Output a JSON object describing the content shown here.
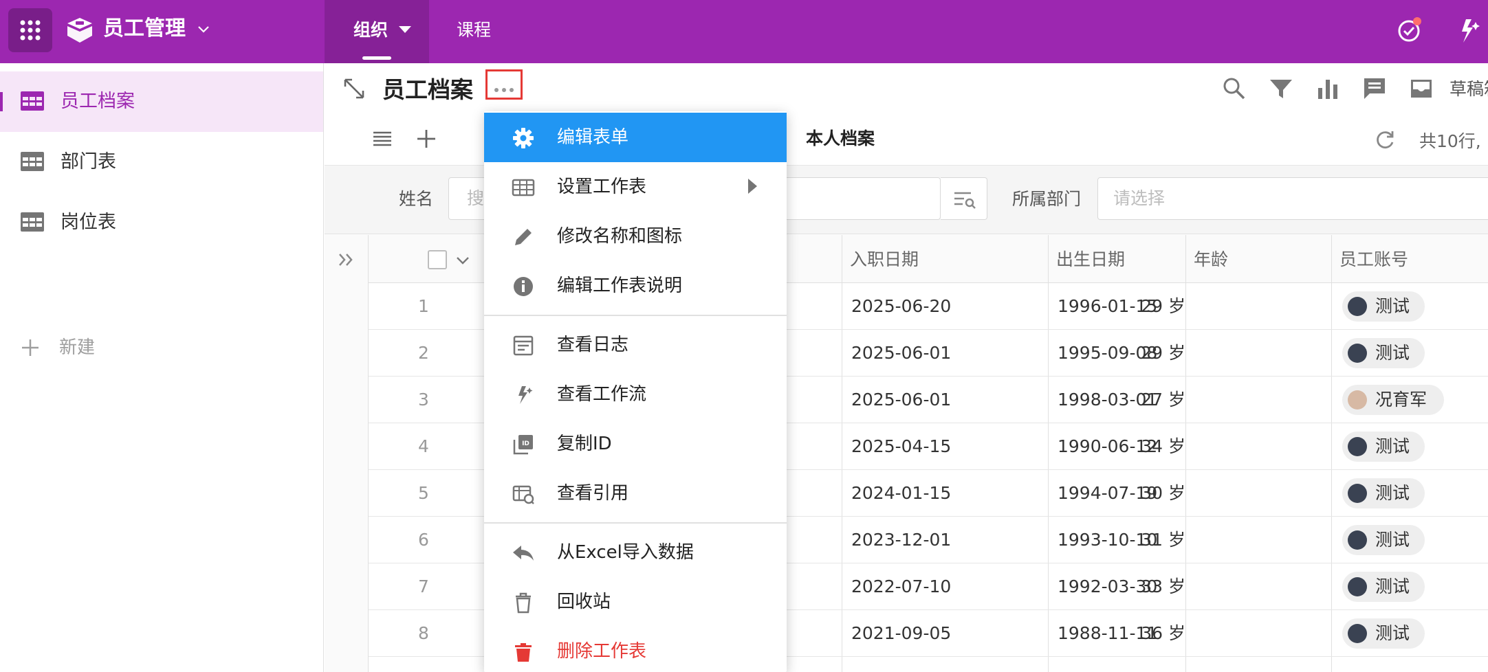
{
  "app": {
    "title": "员工管理"
  },
  "nav": {
    "tabs": [
      {
        "label": "组织"
      },
      {
        "label": "课程"
      }
    ]
  },
  "sidebar": {
    "items": [
      {
        "label": "员工档案"
      },
      {
        "label": "部门表"
      },
      {
        "label": "岗位表"
      }
    ],
    "new_label": "新建"
  },
  "sheet": {
    "title": "员工档案",
    "view_name": "本人档案",
    "draft_label": "草稿箱",
    "row_count": "共10行,"
  },
  "filters": {
    "name_label": "姓名",
    "name_placeholder": "搜",
    "dept_label": "所属部门",
    "dept_placeholder": "请选择"
  },
  "table": {
    "columns": [
      "入职日期",
      "出生日期",
      "年龄",
      "员工账号"
    ],
    "rows": [
      {
        "num": "1",
        "hire_date": "2025-06-20",
        "birth_date": "1996-01-15",
        "age": "29 岁",
        "account": "测试"
      },
      {
        "num": "2",
        "hire_date": "2025-06-01",
        "birth_date": "1995-09-08",
        "age": "29 岁",
        "account": "测试"
      },
      {
        "num": "3",
        "hire_date": "2025-06-01",
        "birth_date": "1998-03-01",
        "age": "27 岁",
        "account": "况育军"
      },
      {
        "num": "4",
        "hire_date": "2025-04-15",
        "birth_date": "1990-06-12",
        "age": "34 岁",
        "account": "测试"
      },
      {
        "num": "5",
        "hire_date": "2024-01-15",
        "birth_date": "1994-07-19",
        "age": "30 岁",
        "account": "测试"
      },
      {
        "num": "6",
        "hire_date": "2023-12-01",
        "birth_date": "1993-10-10",
        "age": "31 岁",
        "account": "测试"
      },
      {
        "num": "7",
        "hire_date": "2022-07-10",
        "birth_date": "1992-03-30",
        "age": "33 岁",
        "account": "测试"
      },
      {
        "num": "8",
        "hire_date": "2021-09-05",
        "birth_date": "1988-11-11",
        "age": "36 岁",
        "account": "测试"
      }
    ]
  },
  "menu": {
    "items": [
      {
        "label": "编辑表单",
        "icon": "gear-icon",
        "state": "highlighted"
      },
      {
        "label": "设置工作表",
        "icon": "table-icon",
        "submenu": true
      },
      {
        "label": "修改名称和图标",
        "icon": "pencil-icon"
      },
      {
        "label": "编辑工作表说明",
        "icon": "info-icon"
      },
      {
        "label": "查看日志",
        "icon": "log-icon"
      },
      {
        "label": "查看工作流",
        "icon": "workflow-icon"
      },
      {
        "label": "复制ID",
        "icon": "copy-id-icon"
      },
      {
        "label": "查看引用",
        "icon": "reference-icon"
      },
      {
        "label": "从Excel导入数据",
        "icon": "import-icon"
      },
      {
        "label": "回收站",
        "icon": "trash-icon"
      },
      {
        "label": "删除工作表",
        "icon": "delete-icon",
        "danger": true
      }
    ]
  },
  "colors": {
    "brand": "#9c27b0",
    "menu_highlight": "#2196f3",
    "danger": "#e53935",
    "sidebar_active_bg": "#f6e6f8"
  }
}
